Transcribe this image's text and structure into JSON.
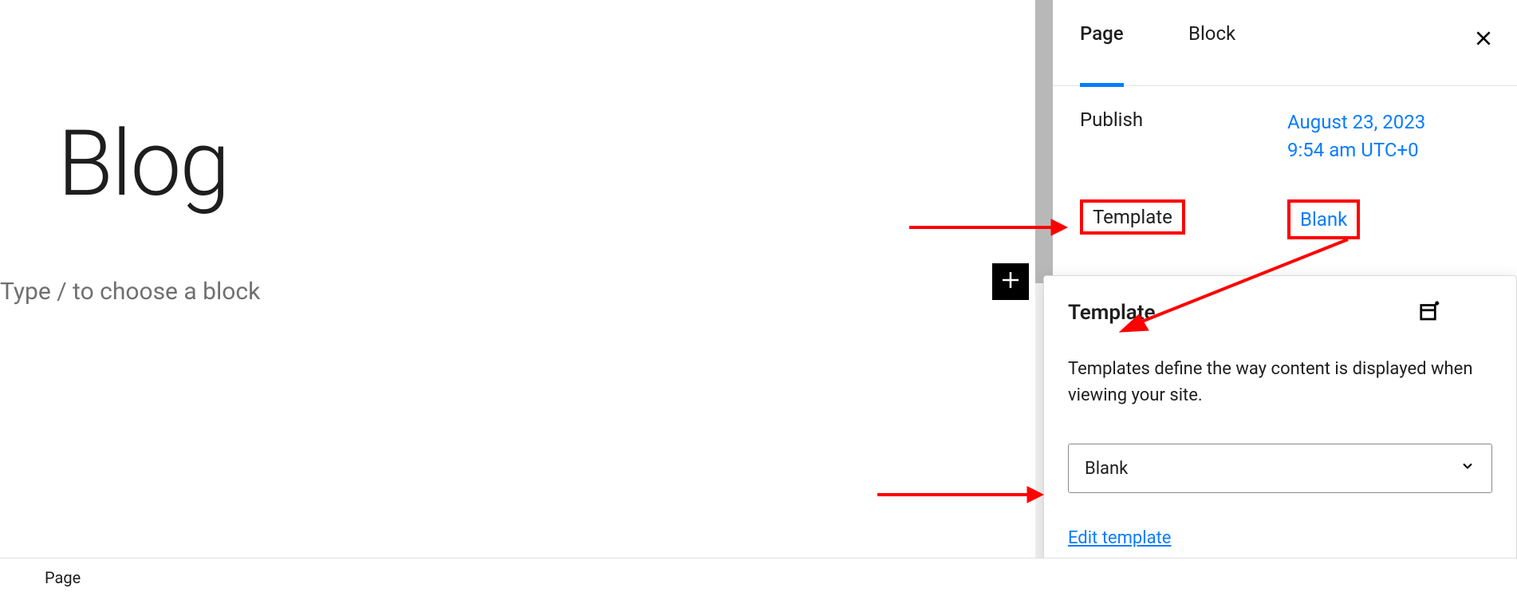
{
  "editor": {
    "post_title": "Blog",
    "block_placeholder": "Type / to choose a block"
  },
  "footer": {
    "breadcrumb": "Page"
  },
  "sidebar": {
    "tabs": {
      "page": "Page",
      "block": "Block"
    },
    "publish": {
      "label": "Publish",
      "date_line1": "August 23, 2023",
      "date_line2": "9:54 am UTC+0"
    },
    "template_row": {
      "label": "Template",
      "value": "Blank"
    }
  },
  "popover": {
    "title": "Template",
    "description": "Templates define the way content is displayed when viewing your site.",
    "selected_template": "Blank",
    "edit_link": "Edit template"
  }
}
